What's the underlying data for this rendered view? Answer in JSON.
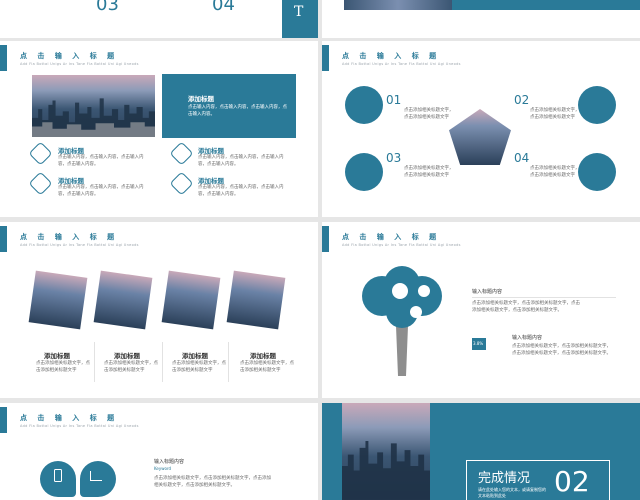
{
  "slide_top": {
    "num_a": "03",
    "num_b": "04",
    "side_label": "T"
  },
  "slide_a": {
    "title": "点 击 输 入 标 题",
    "subtitle": "Add Fla Bottal Unigs Ar Ins Tane Fla Bottal Uni Agi Uneods",
    "box_title": "添加标题",
    "box_text": "点击输入内容，点击输入内容，点击输入内容，点击输入内容。",
    "items": [
      {
        "title": "添加标题",
        "text": "点击输入内容，点击输入内容，点击输入内容，点击输入内容。",
        "icon": "pie-chart-icon"
      },
      {
        "title": "添加标题",
        "text": "点击输入内容，点击输入内容，点击输入内容，点击输入内容。",
        "icon": "settings-icon"
      },
      {
        "title": "添加标题",
        "text": "点击输入内容，点击输入内容，点击输入内容，点击输入内容。",
        "icon": "paper-plane-icon"
      },
      {
        "title": "添加标题",
        "text": "点击输入内容，点击输入内容，点击输入内容，点击输入内容。",
        "icon": "pen-icon"
      }
    ]
  },
  "slide_b": {
    "title": "点 击 输 入 标 题",
    "subtitle": "Add Fla Bottal Unigs Ar Ins Tane Fla Bottal Uni Agi Uneods",
    "items": [
      {
        "num": "01",
        "text": "点击添加相关标题文字，点击添加相关标题文字"
      },
      {
        "num": "02",
        "text": "点击添加相关标题文字，点击添加相关标题文字"
      },
      {
        "num": "03",
        "text": "点击添加相关标题文字，点击添加相关标题文字"
      },
      {
        "num": "04",
        "text": "点击添加相关标题文字，点击添加相关标题文字"
      }
    ]
  },
  "slide_c": {
    "title": "点 击 输 入 标 题",
    "subtitle": "Add Fla Bottal Unigs Ar Ins Tane Fla Bottal Uni Agi Uneods",
    "cards": [
      {
        "title": "添加标题",
        "text": "点击添加相关标题文字，点击添加相关标题文字"
      },
      {
        "title": "添加标题",
        "text": "点击添加相关标题文字，点击添加相关标题文字"
      },
      {
        "title": "添加标题",
        "text": "点击添加相关标题文字，点击添加相关标题文字"
      },
      {
        "title": "添加标题",
        "text": "点击添加相关标题文字，点击添加相关标题文字"
      }
    ]
  },
  "slide_d": {
    "title": "点 击 输 入 标 题",
    "subtitle": "Add Fla Bottal Unigs Ar Ins Tane Fla Bottal Uni Agi Uneods",
    "label_1": "输入标题内容",
    "text_1": "点击添加相关标题文字，点击添加相关标题文字，点击添加相关标题文字，点击添加相关标题文字。",
    "badge": "3.8%",
    "label_2": "输入标题内容",
    "text_2": "点击添加相关标题文字，点击添加相关标题文字，点击添加相关标题文字，点击添加相关标题文字。"
  },
  "slide_e": {
    "title": "点 击 输 入 标 题",
    "subtitle": "Add Fla Bottal Unigs Ar Ins Tane Fla Bottal Uni Agi Uneods",
    "label": "输入标题内容",
    "sublabel": "Keyword",
    "text": "点击添加相关标题文字，点击添加相关标题文字，点击添加相关标题文字，点击添加相关标题文字。"
  },
  "slide_f": {
    "heading": "完成情况",
    "text": "请在此处输入您的文本，或请复制您的文本粘贴到此处",
    "num": "02"
  },
  "colors": {
    "accent": "#2a7a98",
    "bg": "#e6e6e6"
  }
}
